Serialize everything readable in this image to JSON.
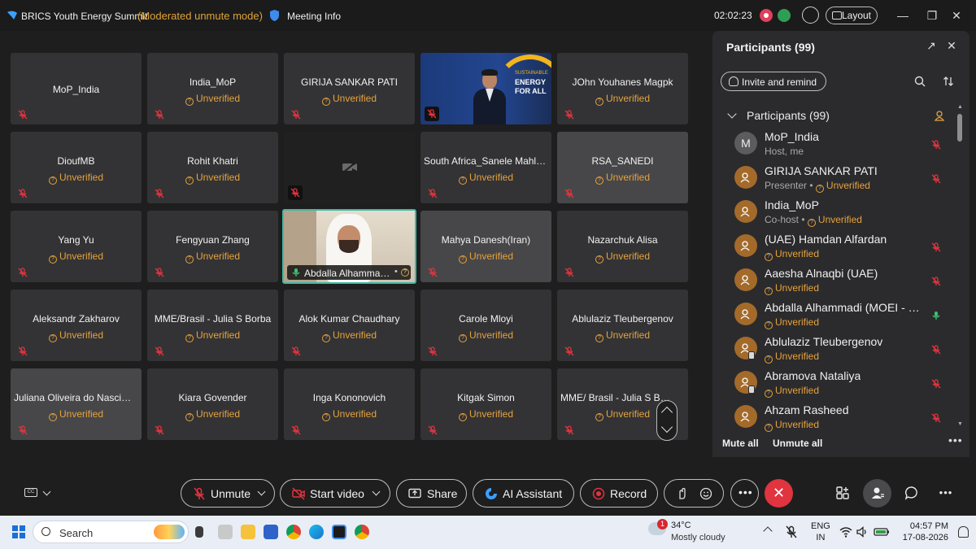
{
  "titlebar": {
    "app_title": "BRICS Youth Energy Summit",
    "mode": "(Moderated unmute mode)",
    "meeting_info": "Meeting Info",
    "timer": "02:02:23",
    "layout_label": "Layout"
  },
  "unverified_label": "Unverified",
  "video_grid": {
    "row1": [
      "MoP_India",
      "India_MoP",
      "GIRIJA SANKAR PATI",
      "",
      "JOhn Youhanes Magpk"
    ],
    "row2": [
      "DioufMB",
      "Rohit Khatri",
      "",
      "South Africa_Sanele Mahlangu",
      "RSA_SANEDI"
    ],
    "row3": [
      "Yang Yu",
      "Fengyuan Zhang",
      "Abdalla Alhammadi (MOEI - UAE)",
      "Mahya Danesh(Iran)",
      "Nazarchuk Alisa"
    ],
    "row4": [
      "Aleksandr Zakharov",
      "MME/Brasil - Julia S Borba",
      "Alok Kumar Chaudhary",
      "Carole Mloyi",
      "Ablulaziz Tleubergenov"
    ],
    "row5": [
      "Juliana Oliveira do Nascimento",
      "Kiara Govender",
      "Inga Kononovich",
      "Kitgak Simon",
      "MME/ Brasil - Julia S Borba"
    ],
    "slide_text": [
      "SUSTAINABLE",
      "ENERGY",
      "FOR ALL"
    ]
  },
  "participants_panel": {
    "title": "Participants (99)",
    "invite_label": "Invite and remind",
    "section_label": "Participants (99)",
    "mute_all": "Mute all",
    "unmute_all": "Unmute all",
    "list": [
      {
        "name": "MoP_India",
        "sub_role": "Host, me",
        "unverified": "",
        "avatar_letter": "M",
        "mic": "muted"
      },
      {
        "name": "GIRIJA SANKAR PATI",
        "sub_role": "Presenter",
        "unverified": "Unverified",
        "mic": "muted"
      },
      {
        "name": "India_MoP",
        "sub_role": "Co-host",
        "unverified": "Unverified",
        "mic": "none"
      },
      {
        "name": "(UAE) Hamdan Alfardan",
        "sub_role": "",
        "unverified": "Unverified",
        "mic": "muted"
      },
      {
        "name": "Aaesha Alnaqbi (UAE)",
        "sub_role": "",
        "unverified": "Unverified",
        "mic": "muted"
      },
      {
        "name": "Abdalla Alhammadi (MOEI - UAE)",
        "sub_role": "",
        "unverified": "Unverified",
        "mic": "active"
      },
      {
        "name": "Ablulaziz Tleubergenov",
        "sub_role": "",
        "unverified": "Unverified",
        "mic": "muted"
      },
      {
        "name": "Abramova Nataliya",
        "sub_role": "",
        "unverified": "Unverified",
        "mic": "muted"
      },
      {
        "name": "Ahzam Rasheed",
        "sub_role": "",
        "unverified": "Unverified",
        "mic": "muted"
      }
    ]
  },
  "toolbar": {
    "unmute": "Unmute",
    "start_video": "Start video",
    "share": "Share",
    "ai_assistant": "AI Assistant",
    "record": "Record"
  },
  "taskbar": {
    "search_placeholder": "Search",
    "weather_badge": "1",
    "temperature": "34°C",
    "condition": "Mostly cloudy",
    "lang_line1": "ENG",
    "lang_line2": "IN",
    "time": "04:57 PM",
    "date": "17-08-2026"
  },
  "colors": {
    "accent_orange": "#e6a23c",
    "mute_red": "#e0343f",
    "active_green": "#3fb8a6",
    "end_call_red": "#e0343f"
  }
}
